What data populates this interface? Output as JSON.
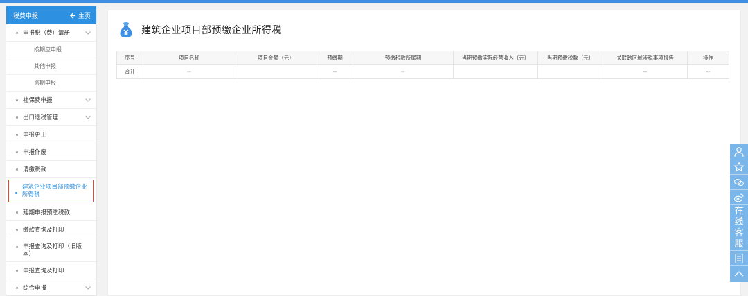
{
  "sidebar": {
    "header_title": "税费申报",
    "home_label": "主页",
    "items": [
      {
        "label": "申报税（费）清册"
      },
      {
        "label": "按期应申报"
      },
      {
        "label": "其他申报"
      },
      {
        "label": "逾期申报"
      },
      {
        "label": "社保费申报"
      },
      {
        "label": "出口退税管理"
      },
      {
        "label": "申报更正"
      },
      {
        "label": "申报作废"
      },
      {
        "label": "清缴税款"
      },
      {
        "label": "建筑企业项目部预缴企业所得税"
      },
      {
        "label": "延期申报预缴税款"
      },
      {
        "label": "缴款查询及打印"
      },
      {
        "label": "申报查询及打印（旧版本）"
      },
      {
        "label": "申报查询及打印"
      },
      {
        "label": "综合申报"
      }
    ]
  },
  "main": {
    "title": "建筑企业项目部预缴企业所得税",
    "table": {
      "headers": [
        "序号",
        "项目名称",
        "项目金额（元）",
        "预缴期",
        "预缴税款所属期",
        "当期预缴实际经营收入（元）",
        "当期预缴税款（元）",
        "关联跨区域涉税事项报告",
        "操作"
      ],
      "rows": [
        [
          "合计",
          "--",
          "",
          "--",
          "--",
          "",
          "",
          "--",
          "--"
        ]
      ]
    }
  },
  "float_bar": {
    "chat_chars": [
      "在",
      "线",
      "客",
      "服"
    ]
  },
  "colors": {
    "primary": "#2d90e0",
    "highlight_border": "#e8472e",
    "float_bar": "#7ab6ea"
  }
}
